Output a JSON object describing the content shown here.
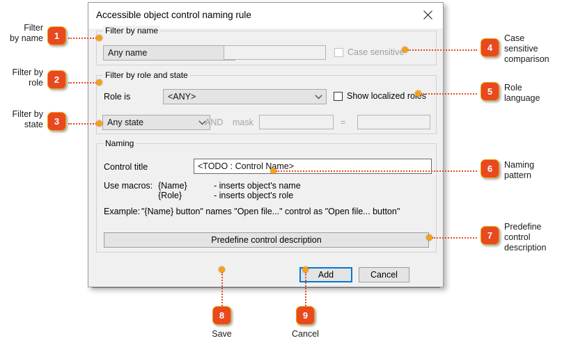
{
  "dialog": {
    "title": "Accessible object control naming rule",
    "close_icon": "close-icon",
    "groups": {
      "filter_by_name": {
        "legend": "Filter by name",
        "name_mode_value": "Any name",
        "name_text_value": "",
        "case_sensitive_label": "Case sensitive",
        "case_sensitive_checked": false,
        "case_sensitive_enabled": false
      },
      "filter_by_role_state": {
        "legend": "Filter by role and state",
        "role_is_label": "Role is",
        "role_value": "<ANY>",
        "show_localized_roles_label": "Show localized roles",
        "show_localized_roles_checked": false,
        "state_value": "Any state",
        "and_label": "AND",
        "mask_label": "mask",
        "mask_value": "",
        "equals_label": "=",
        "equals_value": ""
      },
      "naming": {
        "legend": "Naming",
        "control_title_label": "Control title",
        "control_title_value": "<TODO : Control Name>",
        "use_macros_label": "Use macros:",
        "macros": [
          {
            "token": "{Name}",
            "description": "- inserts object's name"
          },
          {
            "token": "{Role}",
            "description": "- inserts object's role"
          }
        ],
        "example_label": "Example:",
        "example_text": "\"{Name} button\" names \"Open file...\" control as \"Open file... button\""
      }
    },
    "buttons": {
      "predefine": "Predefine control description",
      "add": "Add",
      "cancel": "Cancel"
    }
  },
  "background_window": {
    "clipped_row": [
      "...",
      "..."
    ]
  },
  "callouts": [
    {
      "number": "1",
      "label": "Filter\nby name",
      "side": "left"
    },
    {
      "number": "2",
      "label": "Filter by\nrole",
      "side": "left"
    },
    {
      "number": "3",
      "label": "Filter by\nstate",
      "side": "left"
    },
    {
      "number": "4",
      "label": "Case\nsensitive\ncomparison",
      "side": "right"
    },
    {
      "number": "5",
      "label": "Role\nlanguage",
      "side": "right"
    },
    {
      "number": "6",
      "label": "Naming\npattern",
      "side": "right"
    },
    {
      "number": "7",
      "label": "Predefine\ncontrol\ndescription",
      "side": "right"
    },
    {
      "number": "8",
      "label": "Save",
      "side": "bottom"
    },
    {
      "number": "9",
      "label": "Cancel",
      "side": "bottom"
    }
  ],
  "colors": {
    "callout_badge": "#e8491f",
    "callout_border": "#f0a000",
    "connector": "#e8491f",
    "anchor_dot": "#f4a01c",
    "focus_border": "#0078d7",
    "dialog_bg": "#f0f0f0"
  }
}
